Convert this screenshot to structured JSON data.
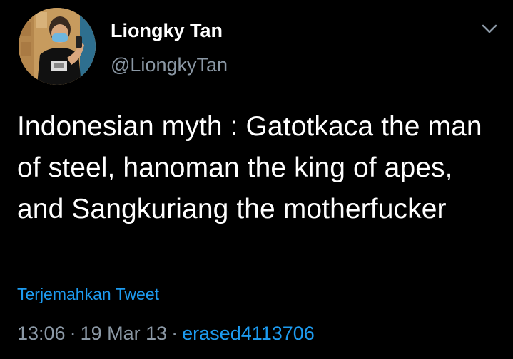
{
  "author": {
    "display_name": "Liongky Tan",
    "handle": "@LiongkyTan",
    "avatar_icon": "profile-photo"
  },
  "tweet": {
    "text": "Indonesian myth : Gatotkaca the man of steel, hanoman the king of apes, and Sangkuriang the motherfucker",
    "translate_label": "Terjemahkan Tweet",
    "time": "13:06",
    "date": "19 Mar 13",
    "source": "erased4113706",
    "separator": "·"
  },
  "menu_icon": "chevron-down-icon",
  "colors": {
    "background": "#000000",
    "primary_text": "#ffffff",
    "secondary_text": "#8b98a5",
    "link": "#1d9bf0"
  }
}
